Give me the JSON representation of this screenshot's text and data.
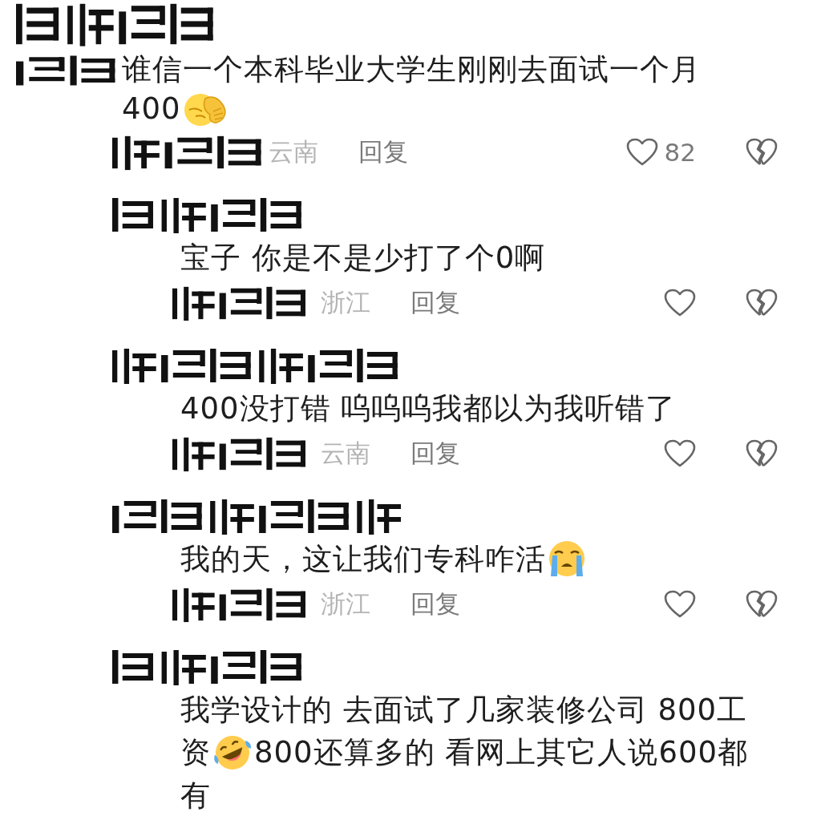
{
  "comments": [
    {
      "lines": [
        [
          {
            "kind": "text",
            "text": "谁信一个本科毕业大学生刚刚去面试一个月"
          }
        ],
        [
          {
            "kind": "text",
            "text": "400"
          },
          {
            "kind": "facepalm"
          }
        ]
      ],
      "location": "云南",
      "reply": "回复",
      "likes": "82",
      "children": [
        {
          "lines": [
            [
              {
                "kind": "text",
                "text": "宝子 你是不是少打了个0啊"
              }
            ]
          ],
          "location": "浙江",
          "reply": "回复"
        },
        {
          "lines": [
            [
              {
                "kind": "text",
                "text": "400没打错 呜呜呜我都以为我听错了"
              }
            ]
          ],
          "location": "云南",
          "reply": "回复"
        },
        {
          "lines": [
            [
              {
                "kind": "text",
                "text": "我的天，这让我们专科咋活"
              },
              {
                "kind": "sob"
              }
            ]
          ],
          "location": "浙江",
          "reply": "回复"
        },
        {
          "lines": [
            [
              {
                "kind": "text",
                "text": "我学设计的 去面试了几家装修公司 800工"
              }
            ],
            [
              {
                "kind": "text",
                "text": "资"
              },
              {
                "kind": "rofl"
              },
              {
                "kind": "text",
                "text": "800还算多的 看网上其它人说600都"
              }
            ],
            [
              {
                "kind": "text",
                "text": "有"
              }
            ]
          ]
        }
      ]
    }
  ]
}
